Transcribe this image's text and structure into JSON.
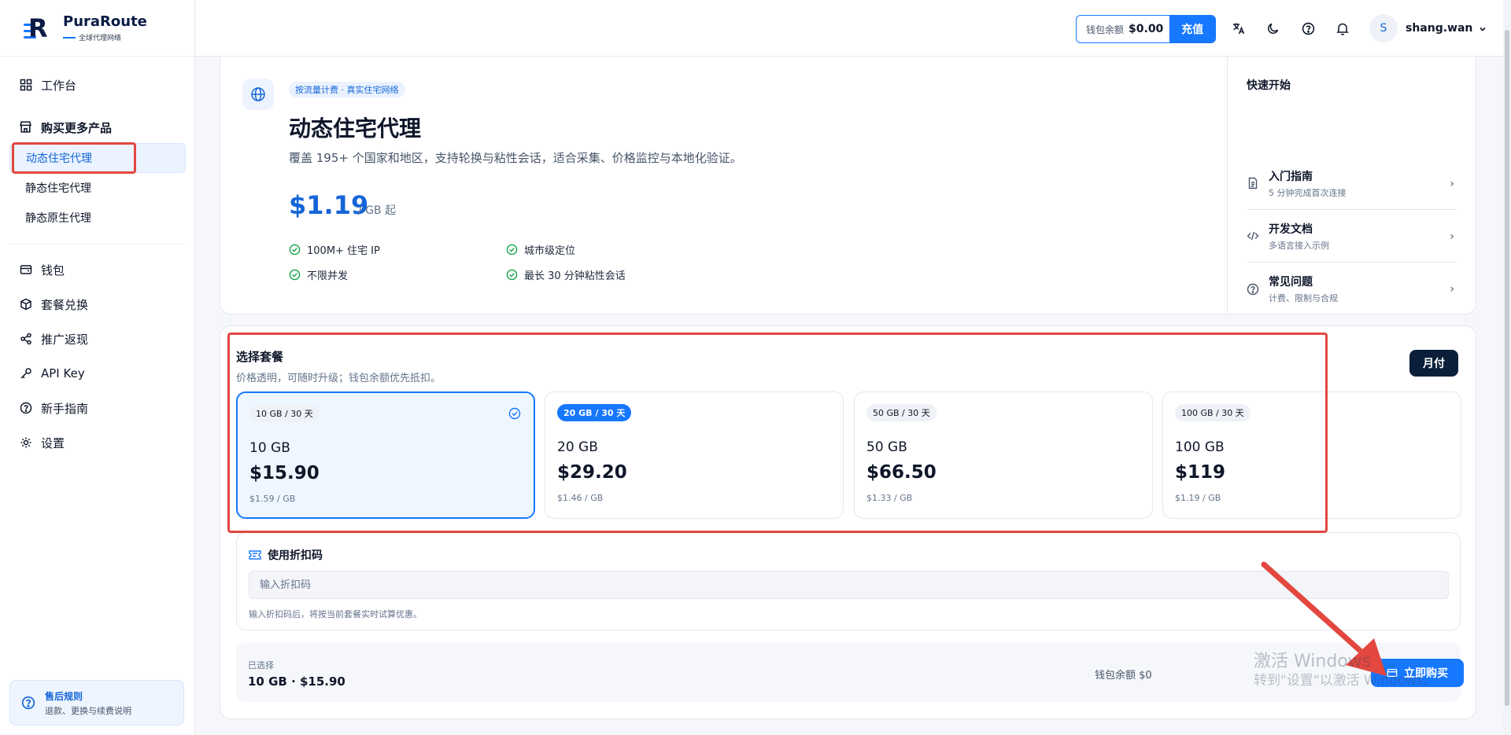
{
  "app": {
    "name": "PuraRoute",
    "tagline": "全球代理网络"
  },
  "sidebar": {
    "workbench": "工作台",
    "buy_group": "购买更多产品",
    "sub_items": [
      "动态住宅代理",
      "静态住宅代理",
      "静态原生代理"
    ],
    "items": [
      "钱包",
      "套餐兑换",
      "推广返现",
      "API Key",
      "新手指南",
      "设置"
    ],
    "support_title": "售后规则",
    "support_desc": "退款、更换与续费说明"
  },
  "topbar": {
    "wallet_label": "钱包余额",
    "wallet_amount": "$0.00",
    "recharge": "充值",
    "avatar_letter": "S",
    "username": "shang.wan"
  },
  "product": {
    "tag": "按流量计费 · 真实住宅网络",
    "title": "动态住宅代理",
    "description": "覆盖 195+ 个国家和地区，支持轮换与粘性会话，适合采集、价格监控与本地化验证。",
    "price": "$1.19",
    "price_unit": "/ GB 起",
    "features": [
      "100M+ 住宅 IP",
      "城市级定位",
      "不限并发",
      "最长 30 分钟粘性会话"
    ]
  },
  "quick_start": {
    "title": "快速开始",
    "items": [
      {
        "title": "入门指南",
        "desc": "5 分钟完成首次连接"
      },
      {
        "title": "开发文档",
        "desc": "多语言接入示例"
      },
      {
        "title": "常见问题",
        "desc": "计费、限制与合规"
      }
    ]
  },
  "plans": {
    "title": "选择套餐",
    "subtitle": "价格透明，可随时升级；钱包余额优先抵扣。",
    "billing": "月付",
    "options": [
      {
        "pill": "10 GB / 30 天",
        "gb": "10 GB",
        "price": "$15.90",
        "per": "$1.59 / GB"
      },
      {
        "pill": "20 GB / 30 天",
        "gb": "20 GB",
        "price": "$29.20",
        "per": "$1.46 / GB"
      },
      {
        "pill": "50 GB / 30 天",
        "gb": "50 GB",
        "price": "$66.50",
        "per": "$1.33 / GB"
      },
      {
        "pill": "100 GB / 30 天",
        "gb": "100 GB",
        "price": "$119",
        "per": "$1.19 / GB"
      }
    ]
  },
  "coupon": {
    "title": "使用折扣码",
    "placeholder": "输入折扣码",
    "hint": "输入折扣码后，将按当前套餐实时试算优惠。"
  },
  "summary": {
    "label": "已选择",
    "selection": "10 GB · $15.90",
    "balance": "钱包余额 $0",
    "buy": "立即购买"
  },
  "watermark": {
    "line1": "激活 Windows",
    "line2": "转到\"设置\"以激活 Windows。"
  },
  "colors": {
    "accent": "#1677ff",
    "highlight": "#e3473f",
    "dark": "#0b1f3a"
  }
}
